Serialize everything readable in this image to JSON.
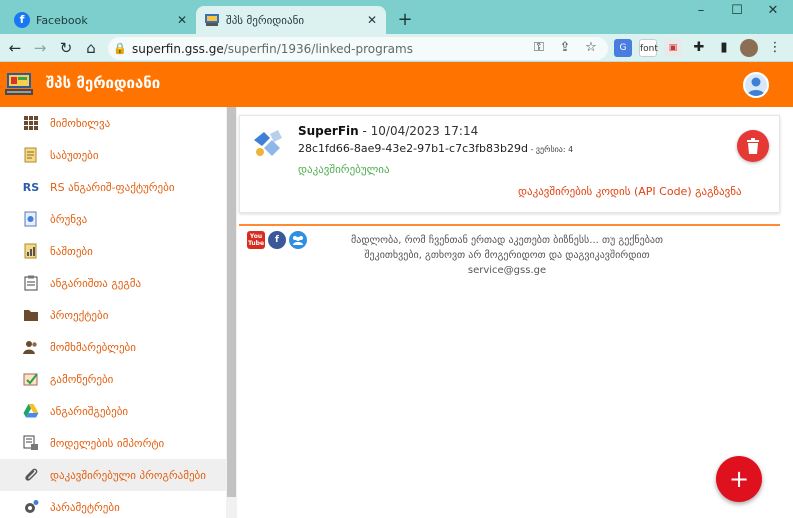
{
  "browser": {
    "tabs": [
      {
        "title": "Facebook",
        "icon": "facebook-icon"
      },
      {
        "title": "შპს მერიდიანი",
        "icon": "meridiani-favicon"
      }
    ],
    "new_tab_symbol": "+",
    "window_controls": [
      "–",
      "☐",
      "✕"
    ],
    "url_domain": "superfin.gss.ge",
    "url_path": "/superfin/1936/linked-programs",
    "extensions": [
      "translate-icon",
      "font",
      "cast-icon",
      "puzzle-icon",
      "sidepanel-icon",
      "profile-avatar"
    ]
  },
  "app": {
    "title": "შპს მერიდიანი",
    "accent": "#ff7400"
  },
  "sidebar": {
    "items": [
      {
        "label": "მიმოხილვა",
        "icon": "grid-icon",
        "active": false
      },
      {
        "label": "საბუთები",
        "icon": "documents-icon",
        "active": false
      },
      {
        "label": "RS ანგარიშ-ფაქტურები",
        "icon": "rs-icon",
        "active": false
      },
      {
        "label": "ბრუნვა",
        "icon": "turnover-icon",
        "active": false
      },
      {
        "label": "ნაშთები",
        "icon": "balances-icon",
        "active": false
      },
      {
        "label": "ანგარიშთა გეგმა",
        "icon": "clipboard-icon",
        "active": false
      },
      {
        "label": "პროექტები",
        "icon": "folder-icon",
        "active": false
      },
      {
        "label": "მომხმარებლები",
        "icon": "users-icon",
        "active": false
      },
      {
        "label": "გამოწერები",
        "icon": "subscriptions-icon",
        "active": false
      },
      {
        "label": "ანგარიშგებები",
        "icon": "google-drive-icon",
        "active": false
      },
      {
        "label": "მოდელების იმპორტი",
        "icon": "import-icon",
        "active": false
      },
      {
        "label": "დაკავშირებული პროგრამები",
        "icon": "paperclip-icon",
        "active": true
      },
      {
        "label": "პარამეტრები",
        "icon": "settings-icon",
        "active": false
      }
    ]
  },
  "card": {
    "program_name": "SuperFin",
    "timestamp": " - 10/04/2023 17:14",
    "uid": "28c1fd66-8ae9-43e2-97b1-c7c3fb83b29d",
    "version": " - ვერსია: 4",
    "status": "დაკავშირებულია",
    "send_link": "დაკავშირების კოდის (API Code) გაგზავნა",
    "status_color": "#4caf50",
    "delete_color": "#e53935"
  },
  "footer": {
    "social": [
      "youtube-icon",
      "facebook-icon",
      "community-icon"
    ],
    "youtube_label": "You Tube",
    "facebook_label": "f",
    "line1": "მადლობა, რომ ჩვენთან ერთად აკეთებთ ბიზნესს... თუ გექნებათ",
    "line2": "შეკითხვები, გთხოვთ არ მოგერიდოთ და დაგვიკავშირდით",
    "email": "service@gss.ge"
  },
  "fab": {
    "symbol": "+"
  }
}
